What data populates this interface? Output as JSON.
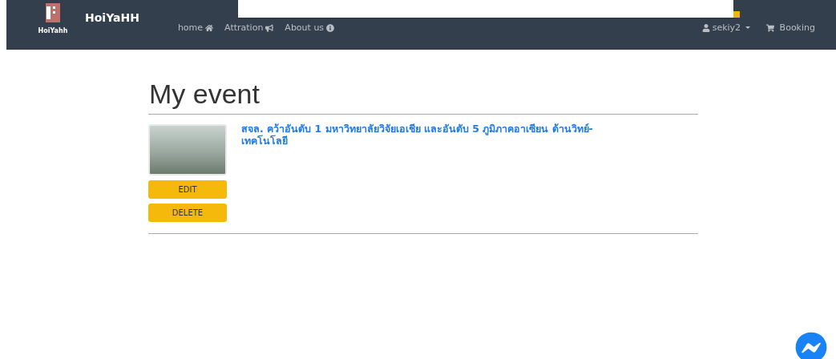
{
  "navbar": {
    "logo_caption": "HoiYahh",
    "brand": "HoiYaHH",
    "links": [
      {
        "label": "home"
      },
      {
        "label": "Attration"
      },
      {
        "label": "About us"
      }
    ],
    "user": "sekiy2",
    "booking": "Booking"
  },
  "page": {
    "title": "My event",
    "events": [
      {
        "title": "สจล. คว้าอันดับ 1 มหาวิทยาลัยวิจัยเอเชีย และอันดับ 5 ภูมิภาคอาเซียน ด้านวิทย์-เทคโนโลยี",
        "actions": [
          "EDIT",
          "DELETE"
        ]
      }
    ]
  }
}
